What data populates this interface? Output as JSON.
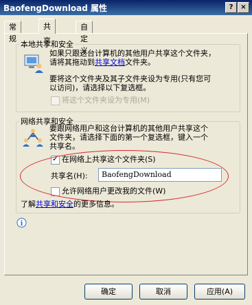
{
  "window": {
    "title": "BaofengDownload 属性",
    "help_btn": "?",
    "close_btn": "×"
  },
  "tabs": [
    {
      "label": "常规",
      "active": false
    },
    {
      "label": "共享",
      "active": true
    },
    {
      "label": "自定义",
      "active": false
    }
  ],
  "local": {
    "legend": "本地共享和安全",
    "desc1": "如果只跟这台计算机的其他用户共享这个文件夹，",
    "desc2a": "请将其拖动到",
    "desc2_link": "共享文档",
    "desc2b": "文件夹。",
    "desc3": "要将这个文件夹及其子文件夹设为专用(只有您可",
    "desc4": "以访问)，请选择以下复选框。",
    "private_checkbox": {
      "label": "将这个文件夹设为专用(M)",
      "checked": false,
      "enabled": false
    }
  },
  "network": {
    "legend": "网络共享和安全",
    "desc1": "要跟网络用户和这台计算机的其他用户共享这个",
    "desc2": "文件夹，请选择下面的第一个复选框，键入一个",
    "desc3": "共享名。",
    "share_checkbox": {
      "label": "在网络上共享这个文件夹(S)",
      "checked": true
    },
    "share_name_label": "共享名(H):",
    "share_name_value": "BaofengDownload",
    "allow_change_checkbox": {
      "label": "允许网络用户更改我的文件(W)",
      "checked": false
    }
  },
  "learn_more": {
    "prefix": "了解",
    "link": "共享和安全",
    "suffix": "的更多信息。"
  },
  "buttons": {
    "ok": "确定",
    "cancel": "取消",
    "apply": "应用(A)"
  },
  "icons": [
    "computer-users-icon",
    "network-users-icon",
    "info-icon"
  ]
}
